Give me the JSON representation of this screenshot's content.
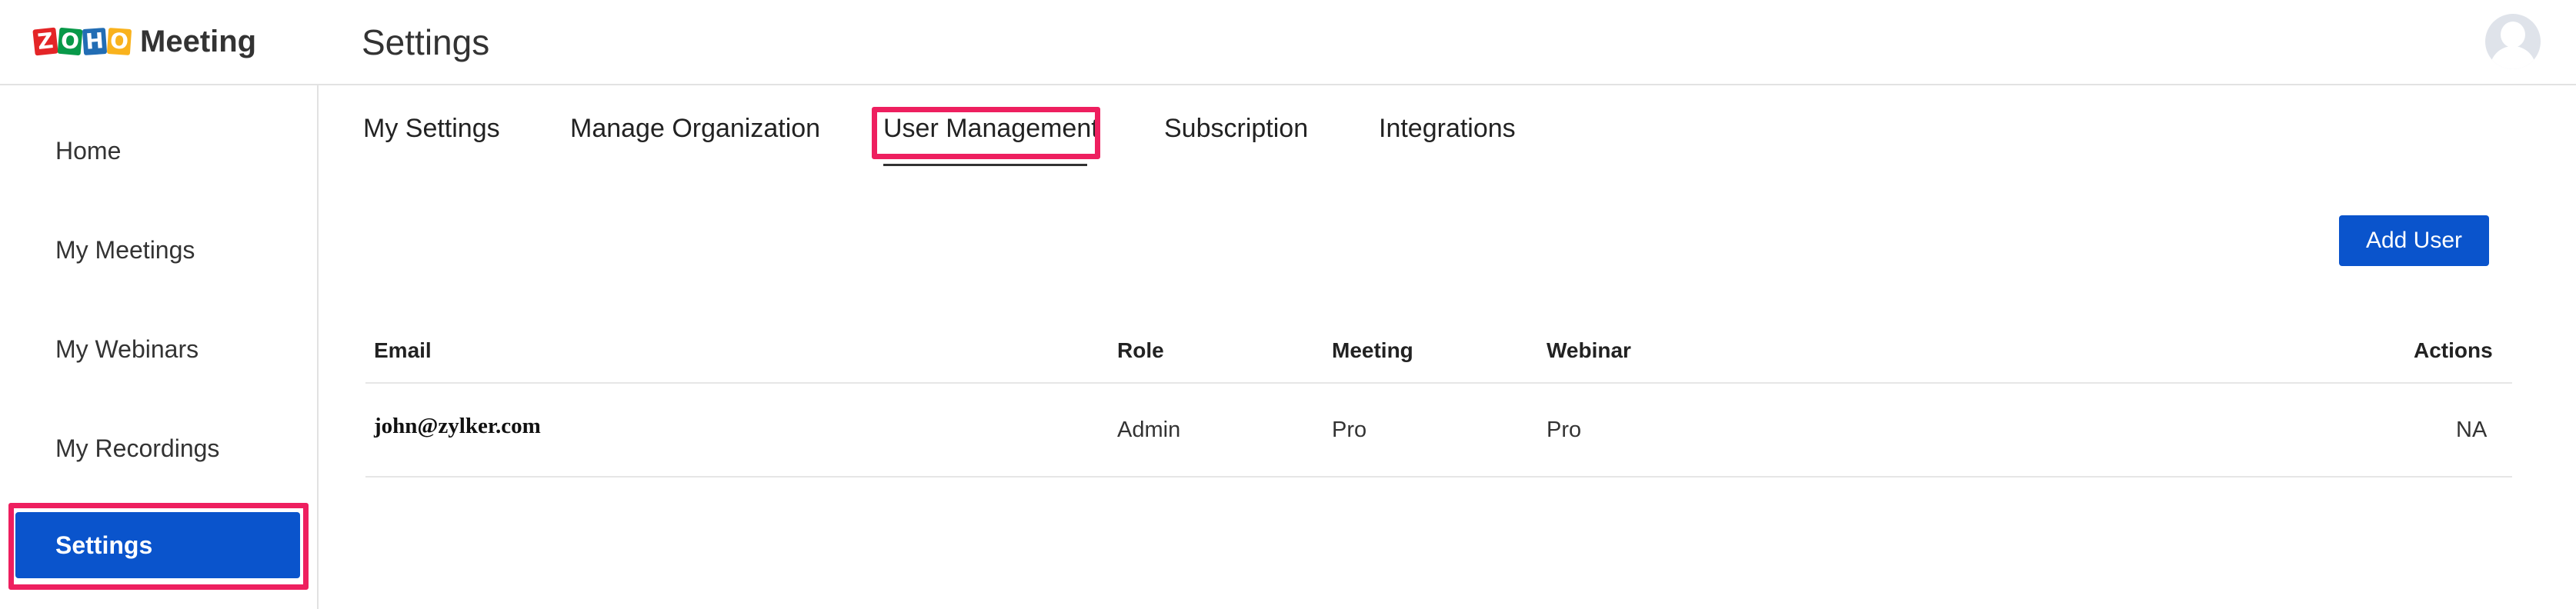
{
  "header": {
    "logo_letters": [
      "Z",
      "O",
      "H",
      "O"
    ],
    "app_name": "Meeting",
    "page_title": "Settings",
    "avatar_icon": "user-avatar-icon"
  },
  "sidebar": {
    "items": [
      {
        "label": "Home",
        "active": false
      },
      {
        "label": "My Meetings",
        "active": false
      },
      {
        "label": "My Webinars",
        "active": false
      },
      {
        "label": "My Recordings",
        "active": false
      },
      {
        "label": "Settings",
        "active": true
      }
    ]
  },
  "tabs": [
    {
      "label": "My Settings",
      "active": false
    },
    {
      "label": "Manage Organization",
      "active": false
    },
    {
      "label": "User Management",
      "active": true
    },
    {
      "label": "Subscription",
      "active": false
    },
    {
      "label": "Integrations",
      "active": false
    }
  ],
  "toolbar": {
    "add_user_label": "Add User"
  },
  "table": {
    "columns": [
      "Email",
      "Role",
      "Meeting",
      "Webinar",
      "Actions"
    ],
    "rows": [
      {
        "email": "john@zylker.com",
        "role": "Admin",
        "meeting": "Pro",
        "webinar": "Pro",
        "actions": "NA"
      }
    ]
  },
  "colors": {
    "accent": "#0a54cc",
    "highlight": "#ee1f5f",
    "divider": "#e2e2e2"
  }
}
